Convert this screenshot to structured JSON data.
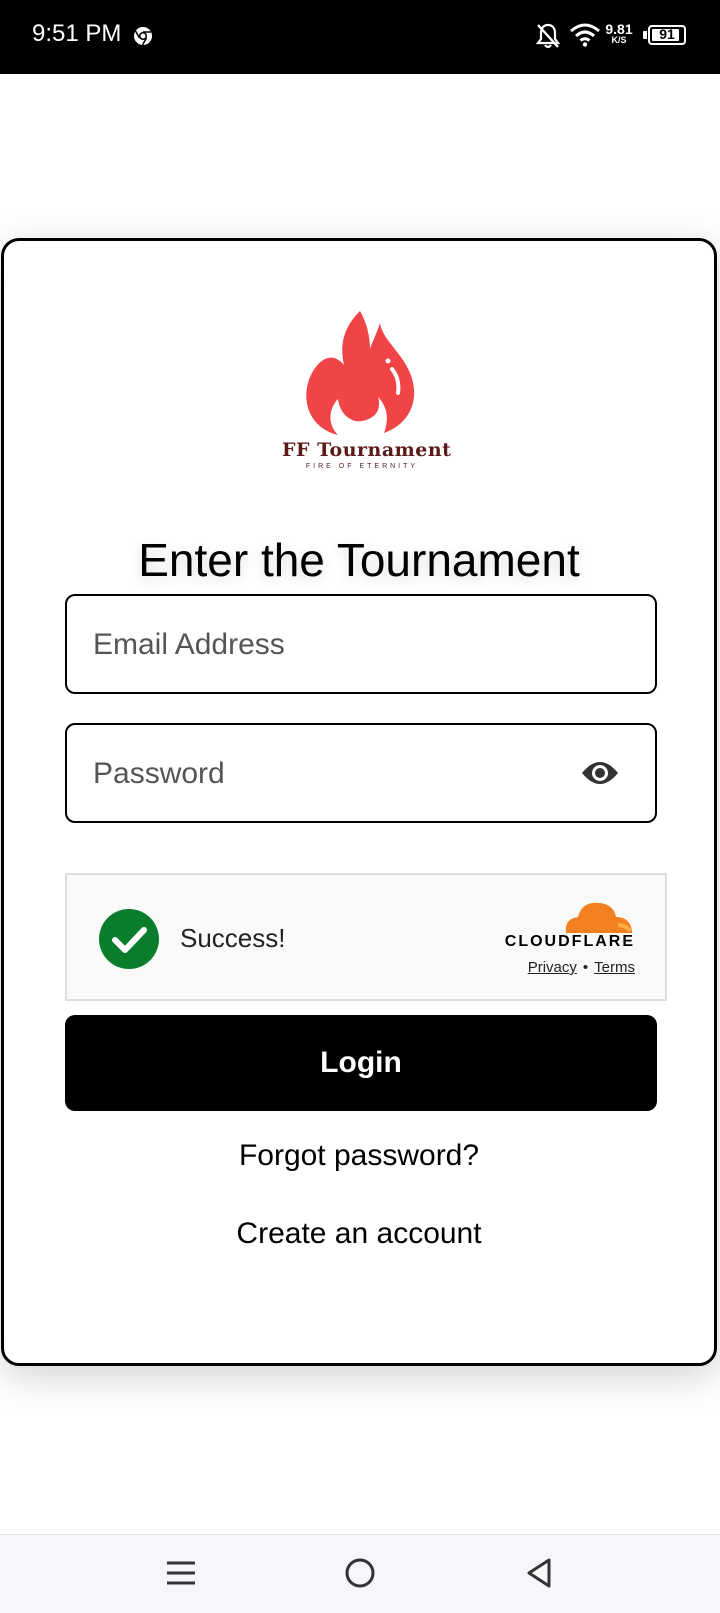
{
  "status_bar": {
    "time": "9:51 PM",
    "net_speed_value": "9.81",
    "net_speed_unit": "K/S",
    "battery_level": "91",
    "battery_fraction": 0.91,
    "icons": [
      "chrome-icon",
      "bell-off-icon",
      "wifi-icon",
      "battery-icon"
    ]
  },
  "logo": {
    "brand": "FF Tournament",
    "tagline": "FIRE OF ETERNITY",
    "flame_color": "#f04447"
  },
  "login_form": {
    "title": "Enter the Tournament",
    "email_placeholder": "Email Address",
    "email_value": "",
    "password_placeholder": "Password",
    "password_value": "",
    "login_label": "Login",
    "forgot_label": "Forgot password?",
    "create_label": "Create an account"
  },
  "captcha": {
    "status": "Success!",
    "provider": "CLOUDFLARE",
    "privacy_label": "Privacy",
    "separator": "•",
    "terms_label": "Terms",
    "success_color": "#0a7d2c",
    "provider_color": "#f38020"
  },
  "nav_bar": {
    "buttons": [
      "menu-icon",
      "home-icon",
      "back-icon"
    ]
  }
}
